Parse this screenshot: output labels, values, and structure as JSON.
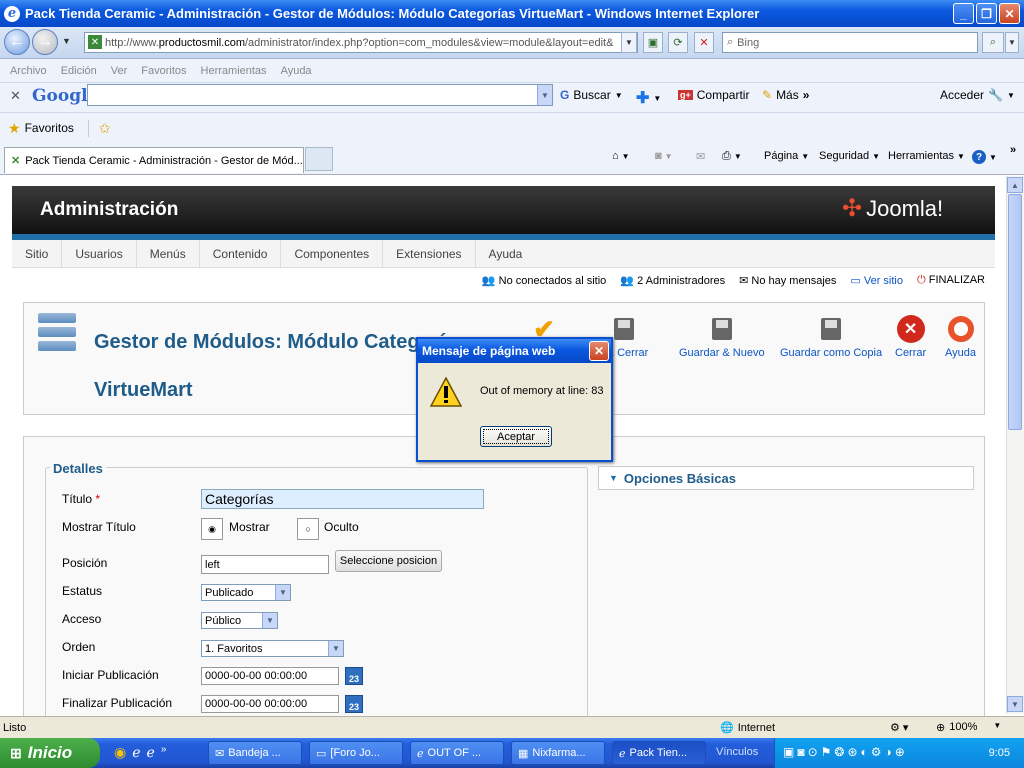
{
  "window": {
    "title": "Pack Tienda Ceramic - Administración - Gestor de Módulos: Módulo Categorías VirtueMart - Windows Internet Explorer"
  },
  "address": {
    "url_prefix": "http://www.",
    "url_domain": "productosmil.com",
    "url_rest": "/administrator/index.php?option=com_modules&view=module&layout=edit&",
    "search_placeholder": "Bing"
  },
  "menu": [
    "Archivo",
    "Edición",
    "Ver",
    "Favoritos",
    "Herramientas",
    "Ayuda"
  ],
  "google_bar": {
    "brand": "Google",
    "buscar": "Buscar",
    "compartir": "Compartir",
    "mas": "Más",
    "acceder": "Acceder"
  },
  "favorites": {
    "label": "Favoritos"
  },
  "tab": {
    "title": "Pack Tienda Ceramic - Administración - Gestor de Mód..."
  },
  "commands": {
    "pagina": "Página",
    "seguridad": "Seguridad",
    "herramientas": "Herramientas"
  },
  "joomla": {
    "header": "Administración",
    "logo": "Joomla!",
    "nav": [
      "Sitio",
      "Usuarios",
      "Menús",
      "Contenido",
      "Componentes",
      "Extensiones",
      "Ayuda"
    ],
    "status": {
      "offline": "No conectados al sitio",
      "admins": "2 Administradores",
      "messages": "No hay mensajes",
      "view_site": "Ver sitio",
      "logout": "FINALIZAR"
    },
    "page_title": "Gestor de Módulos: Módulo Categorías VirtueMart",
    "toolbar": {
      "save_close": "r & Cerrar",
      "save_new": "Guardar & Nuevo",
      "save_copy": "Guardar como Copia",
      "close": "Cerrar",
      "help": "Ayuda"
    },
    "details": {
      "legend": "Detalles",
      "title_label": "Título",
      "required_mark": "*",
      "title_value": "Categorías",
      "show_title_label": "Mostrar Título",
      "show_option": "Mostrar",
      "hide_option": "Oculto",
      "position_label": "Posición",
      "position_value": "left",
      "position_button": "Seleccione posicion",
      "status_label": "Estatus",
      "status_value": "Publicado",
      "access_label": "Acceso",
      "access_value": "Público",
      "order_label": "Orden",
      "order_value": "1. Favoritos",
      "start_label": "Iniciar Publicación",
      "start_value": "0000-00-00 00:00:00",
      "end_label": "Finalizar Publicación",
      "end_value": "0000-00-00 00:00:00",
      "calendar_day": "23"
    },
    "basic_options": "Opciones Básicas"
  },
  "dialog": {
    "title": "Mensaje de página web",
    "message": "Out of memory at line: 83",
    "ok": "Aceptar"
  },
  "statusbar": {
    "left": "Listo",
    "zone": "Internet",
    "zoom": "100%"
  },
  "taskbar": {
    "start": "Inicio",
    "tasks": [
      "Bandeja ...",
      "[Foro Jo...",
      "OUT OF ...",
      "Nixfarma...",
      "Pack Tien..."
    ],
    "vinculos": "Vínculos",
    "clock": "9:05"
  },
  "colors": {
    "title_blue": "#0a58e0",
    "joomla_blue": "#1f5c8a",
    "link_blue": "#0b55c4"
  }
}
